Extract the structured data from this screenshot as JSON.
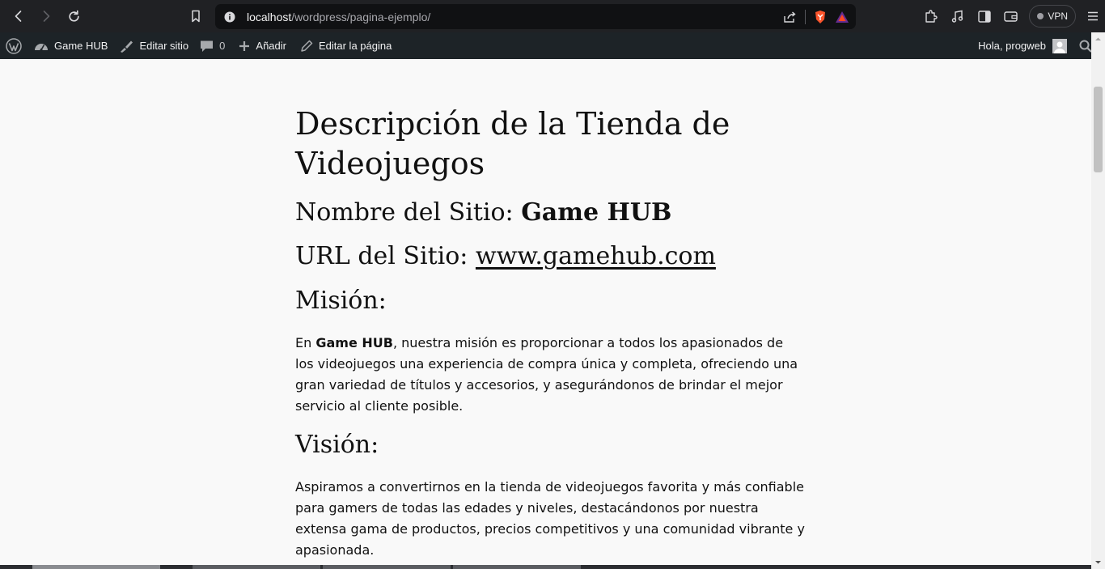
{
  "browser": {
    "url_host": "localhost",
    "url_path": "/wordpress/pagina-ejemplo/",
    "vpn_label": "VPN"
  },
  "admin_bar": {
    "site_name": "Game HUB",
    "edit_site": "Editar sitio",
    "comments_count": "0",
    "add_new": "Añadir",
    "edit_page": "Editar la página",
    "greeting": "Hola, progweb"
  },
  "page": {
    "title": "Descripción de la Tienda de Videojuegos",
    "name_label": "Nombre del Sitio: ",
    "name_value": "Game HUB",
    "url_label": "URL del Sitio: ",
    "url_value": "www.gamehub.com",
    "mision_heading": "Misión:",
    "mision_prefix": "En ",
    "mision_bold": "Game HUB",
    "mision_text": ", nuestra misión es proporcionar a todos los apasionados de los videojuegos una experiencia de compra única y completa, ofreciendo una gran variedad de títulos y accesorios, y asegurándonos de brindar el mejor servicio al cliente posible.",
    "vision_heading": "Visión:",
    "vision_text": "Aspiramos a convertirnos en la tienda de videojuegos favorita y más confiable para gamers de todas las edades y niveles, destacándonos por nuestra extensa gama de productos, precios competitivos y una comunidad vibrante y apasionada."
  }
}
